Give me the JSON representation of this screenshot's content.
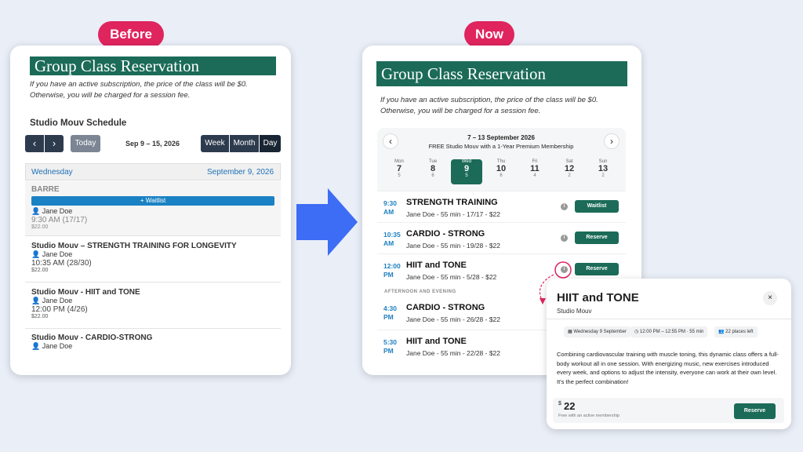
{
  "labels": {
    "before": "Before",
    "now": "Now"
  },
  "before": {
    "title": "Group Class Reservation",
    "note": "If you have an active subscription, the price of the class will be $0. Otherwise, you will be charged for a session fee.",
    "schedule_title": "Studio Mouv Schedule",
    "prev": "‹",
    "next": "›",
    "today": "Today",
    "range": "Sep 9 – 15, 2026",
    "views": [
      "Week",
      "Month",
      "Day"
    ],
    "day_name": "Wednesday",
    "day_date": "September 9, 2026",
    "barre": {
      "name": "BARRE",
      "waitlist": "+ Waitlist",
      "instructor": "Jane Doe",
      "time": "9:30 AM (17/17)",
      "price": "$22.00"
    },
    "classes": [
      {
        "name": "Studio Mouv – STRENGTH TRAINING FOR LONGEVITY",
        "instructor": "Jane Doe",
        "time": "10:35 AM (28/30)",
        "price": "$22.00"
      },
      {
        "name": "Studio Mouv - HIIT and TONE",
        "instructor": "Jane Doe",
        "time": "12:00 PM (4/26)",
        "price": "$22.00"
      },
      {
        "name": "Studio Mouv - CARDIO-STRONG",
        "instructor": "Jane Doe",
        "time": "",
        "price": ""
      }
    ]
  },
  "now": {
    "title": "Group Class Reservation",
    "note": "If you have an active subscription, the price of the class will be $0. Otherwise, you will be charged for a session fee.",
    "range": "7 – 13 September 2026",
    "promo": "FREE Studio Mouv with a 1-Year Premium Membership",
    "days": [
      {
        "n": "Mon",
        "d": "7",
        "c": "5"
      },
      {
        "n": "Tue",
        "d": "8",
        "c": "6"
      },
      {
        "n": "Wed",
        "d": "9",
        "c": "5"
      },
      {
        "n": "Thu",
        "d": "10",
        "c": "6"
      },
      {
        "n": "Fri",
        "d": "11",
        "c": "4"
      },
      {
        "n": "Sat",
        "d": "12",
        "c": "2"
      },
      {
        "n": "Sun",
        "d": "13",
        "c": "2"
      }
    ],
    "classes": [
      {
        "t1": "9:30",
        "t2": "AM",
        "name": "STRENGTH TRAINING",
        "sub": "Jane Doe - 55 min - 17/17 - $22",
        "btn": "Waitlist"
      },
      {
        "t1": "10:35",
        "t2": "AM",
        "name": "CARDIO - STRONG",
        "sub": "Jane Doe - 55 min - 19/28 - $22",
        "btn": "Reserve"
      },
      {
        "t1": "12:00",
        "t2": "PM",
        "name": "HIIT and TONE",
        "sub": "Jane Doe - 55 min - 5/28 - $22",
        "btn": "Reserve"
      },
      {
        "t1": "4:30",
        "t2": "PM",
        "name": "CARDIO - STRONG",
        "sub": "Jane Doe - 55 min - 26/28 - $22",
        "btn": ""
      },
      {
        "t1": "5:30",
        "t2": "PM",
        "name": "HIIT and TONE",
        "sub": "Jane Doe - 55 min - 22/28 - $22",
        "btn": ""
      }
    ],
    "section": "AFTERNOON AND EVENING"
  },
  "popup": {
    "title": "HIIT and TONE",
    "studio": "Studio Mouv",
    "close": "×",
    "date": "Wednesday 9 September",
    "time": "12:00 PM – 12:55 PM · 55 min",
    "places": "22 places left",
    "desc": "Combining cardiovascular training with muscle toning, this dynamic class offers a full-body workout all in one session. With energizing music, new exercises introduced every week, and options to adjust the intensity, everyone can work at their own level. It's the perfect combination!",
    "currency": "$",
    "price": "22",
    "price_note": "Free with an active membership",
    "btn": "Reserve"
  },
  "colors": {
    "accent": "#1b6b58",
    "pill": "#e0245e",
    "arrow": "#3d6cf5"
  }
}
